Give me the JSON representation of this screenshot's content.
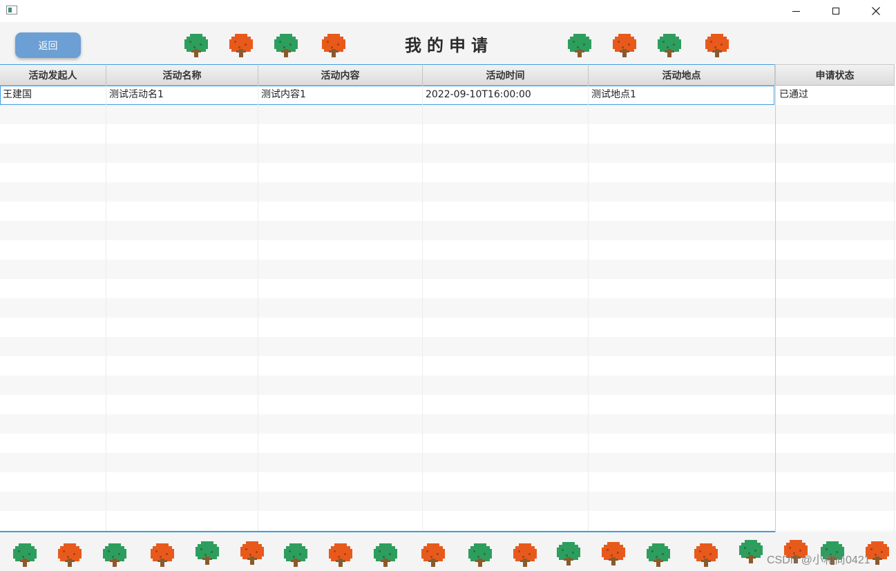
{
  "header": {
    "back_label": "返回",
    "title": "我的申请"
  },
  "table": {
    "columns": [
      "活动发起人",
      "活动名称",
      "活动内容",
      "活动时间",
      "活动地点",
      "申请状态"
    ],
    "rows": [
      [
        "王建国",
        "测试活动名1",
        "测试内容1",
        "2022-09-10T16:00:00",
        "测试地点1",
        "已通过"
      ]
    ]
  },
  "icons": {
    "tree_green": "tree-green-icon",
    "tree_orange": "tree-orange-icon"
  },
  "colors": {
    "accent": "#3d9ee0",
    "button": "#6c9fd4",
    "tree_green": "#2e9e5e",
    "tree_orange": "#e85a1c",
    "trunk": "#8a5a2b"
  },
  "watermark": "CSDN @小和尚0421"
}
